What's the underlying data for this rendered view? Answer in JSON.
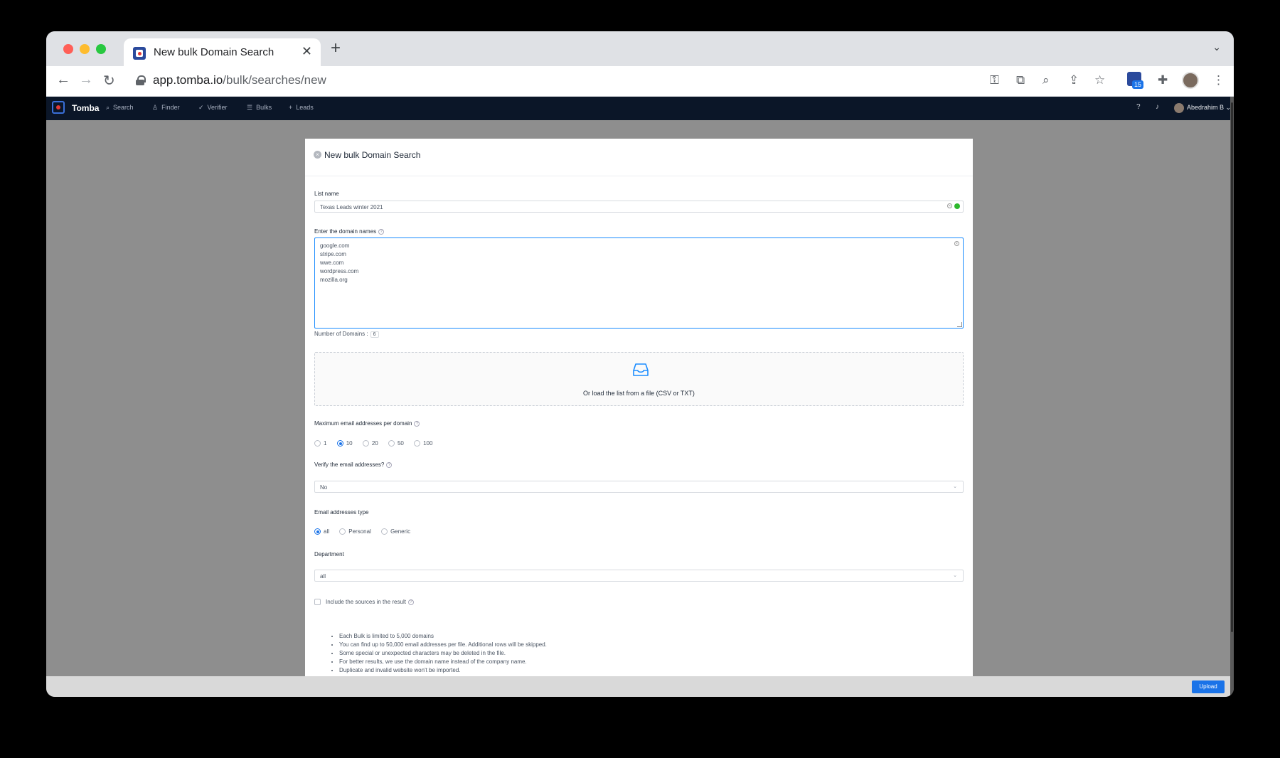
{
  "browser": {
    "tab_title": "New bulk Domain Search",
    "url_domain": "app.tomba.io",
    "url_path": "/bulk/searches/new",
    "extension_badge": "15"
  },
  "app": {
    "brand": "Tomba",
    "nav": [
      {
        "icon": "search-icon",
        "label": "Search"
      },
      {
        "icon": "user-icon",
        "label": "Finder"
      },
      {
        "icon": "check-icon",
        "label": "Verifier"
      },
      {
        "icon": "list-icon",
        "label": "Bulks"
      },
      {
        "icon": "plus-icon",
        "label": "Leads"
      }
    ],
    "user_name": "Abedrahim B"
  },
  "modal": {
    "title": "New bulk Domain Search",
    "list_name_label": "List name",
    "list_name_value": "Texas Leads winter 2021",
    "domains_label": "Enter the domain names",
    "domains": [
      "google.com",
      "stripe.com",
      "wwe.com",
      "wordpress.com",
      "mozilla.org"
    ],
    "domain_count_label": "Number of Domains :",
    "domain_count": "6",
    "dropzone_text": "Or load the list from a file (CSV or TXT)",
    "max_emails_label": "Maximum email addresses per domain",
    "max_emails_options": [
      "1",
      "10",
      "20",
      "50",
      "100"
    ],
    "max_emails_selected": "10",
    "verify_label": "Verify the email addresses?",
    "verify_value": "No",
    "email_type_label": "Email addresses type",
    "email_type_options": [
      "all",
      "Personal",
      "Generic"
    ],
    "email_type_selected": "all",
    "department_label": "Department",
    "department_value": "all",
    "include_sources_label": "Include the sources in the result",
    "notes": [
      "Each Bulk is limited to 5,000 domains",
      "You can find up to 50,000 email addresses per file. Additional rows will be skipped.",
      "Some special or unexpected characters may be deleted in the file.",
      "For better results, we use the domain name instead of the company name.",
      "Duplicate and invalid website won't be imported."
    ]
  },
  "footer": {
    "upload_label": "Upload"
  },
  "colors": {
    "primary": "#1a73e8",
    "appbar": "#0b1628",
    "success": "#2eb82e"
  }
}
